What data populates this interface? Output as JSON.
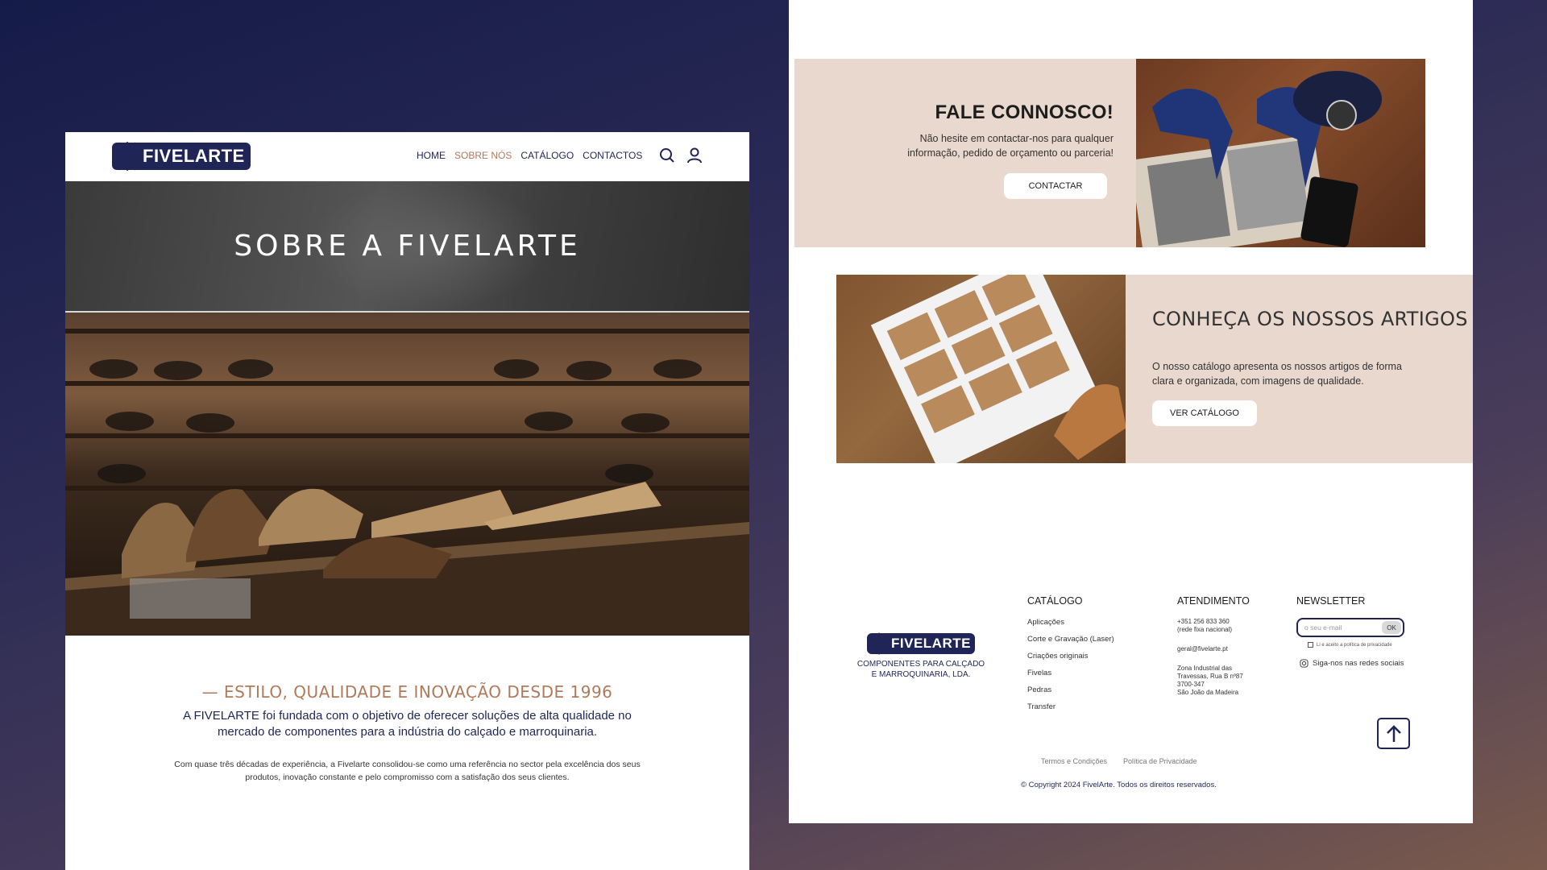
{
  "brand": {
    "name": "FIVELARTE",
    "navy": "#1f2657",
    "accent": "#b07a5a",
    "sand": "#e8d8cd"
  },
  "left": {
    "nav": {
      "items": [
        {
          "label": "HOME"
        },
        {
          "label": "SOBRE NÓS",
          "active": true
        },
        {
          "label": "CATÁLOGO"
        },
        {
          "label": "CONTACTOS"
        }
      ],
      "icons": [
        "search-icon",
        "user-icon"
      ]
    },
    "hero_title": "SOBRE A FIVELARTE",
    "intro": {
      "kicker": "— ESTILO, QUALIDADE E INOVAÇÃO DESDE 1996",
      "lead": "A FIVELARTE foi fundada com o objetivo de oferecer soluções de alta qualidade no mercado de componentes para a indústria do calçado e marroquinaria.",
      "body": "Com quase três décadas de experiência, a Fivelarte consolidou-se como uma referência no sector pela excelência dos seus produtos, inovação constante e pelo compromisso com a satisfação dos seus clientes."
    }
  },
  "right": {
    "contact_card": {
      "title": "FALE CONNOSCO!",
      "text": "Não hesite em contactar-nos para qualquer informação, pedido de orçamento ou parceria!",
      "button": "CONTACTAR"
    },
    "catalog_card": {
      "title": "CONHEÇA OS NOSSOS ARTIGOS",
      "text": "O nosso catálogo apresenta os nossos artigos de forma clara e organizada, com imagens de qualidade.",
      "button": "VER CATÁLOGO"
    },
    "footer": {
      "tagline": "COMPONENTES PARA CALÇADO E MARROQUINARIA, LDA.",
      "catalog": {
        "heading": "CATÁLOGO",
        "links": [
          "Aplicações",
          "Corte e Gravação (Laser)",
          "Criações originais",
          "Fivelas",
          "Pedras",
          "Transfer"
        ]
      },
      "service": {
        "heading": "ATENDIMENTO",
        "phone": "+351 256 833 360",
        "phone_note": "(rede fixa nacional)",
        "email": "geral@fivelarte.pt",
        "address": [
          "Zona Industrial das",
          "Travessas, Rua B nº87",
          "3700-347",
          "São João da Madeira"
        ]
      },
      "newsletter": {
        "heading": "NEWSLETTER",
        "placeholder": "o seu e-mail",
        "ok": "OK",
        "consent": "Li e aceito a política de privacidade",
        "social": "Siga-nos nas redes sociais"
      },
      "legal": [
        "Termos e Condições",
        "Política de Privacidade"
      ],
      "copyright": "© Copyright 2024 FivelArte. Todos os direitos reservados."
    }
  }
}
